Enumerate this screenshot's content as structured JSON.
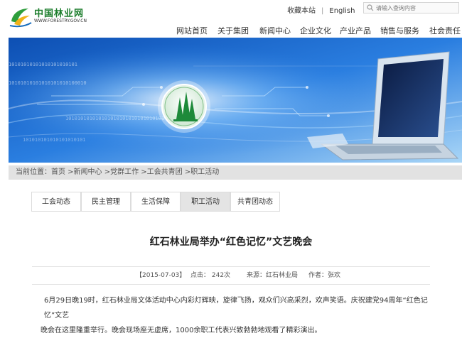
{
  "header": {
    "logo_title": "中国林业网",
    "logo_sub": "WWW.FORESTRY.GOV.CN",
    "collect_label": "收藏本站",
    "separator": "|",
    "english_label": "English",
    "search_placeholder": "请输入查询内容"
  },
  "nav": {
    "items": [
      {
        "label": "网站首页"
      },
      {
        "label": "关于集团"
      },
      {
        "label": "新闻中心"
      },
      {
        "label": "企业文化"
      },
      {
        "label": "产业产品"
      },
      {
        "label": "销售与服务"
      },
      {
        "label": "社会责任"
      }
    ]
  },
  "banner": {
    "binary_text_1": "10101010101010101010101",
    "binary_text_2": "10101010101010101010100010",
    "binary_text_3": "101010101010101010101010101010101",
    "binary_text_4": "101010101010101010101"
  },
  "breadcrumb": {
    "text": "当前位置：首页 >新闻中心 >党群工作 >工会共青团 >职工活动"
  },
  "tabs": [
    {
      "label": "工会动态",
      "active": false
    },
    {
      "label": "民主管理",
      "active": false
    },
    {
      "label": "生活保障",
      "active": false
    },
    {
      "label": "职工活动",
      "active": true
    },
    {
      "label": "共青团动态",
      "active": false
    }
  ],
  "article": {
    "title": "红石林业局举办“红色记忆”文艺晚会",
    "date": "【2015-07-03】",
    "views": "点击： 242次",
    "source": "来源：红石林业局",
    "author": "作者：张欢",
    "paragraph1": "6月29日晚19时，红石林业局文体活动中心内彩灯辉映，旋律飞扬，观众们兴高采烈，欢声笑语。庆祝建党94周年“红色记忆”文艺",
    "paragraph2": "晚会在这里隆重举行。晚会现场座无虚席，1000余职工代表兴致勃勃地观看了精彩演出。"
  },
  "colors": {
    "brand_green": "#1c7d2c",
    "banner_blue": "#1b6fd0",
    "active_tab": "#e4e4e4"
  }
}
